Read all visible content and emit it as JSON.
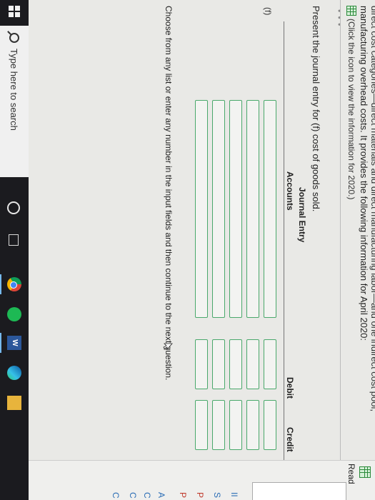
{
  "header": {
    "cut_line": "direct cost categories—direct materials and direct manufacturing labor—and one indirect cost pool,",
    "line2": "manufacturing overhead costs. It provides the following information for April 2020:",
    "click_note": "(Click the icon to view the information for 2020.)",
    "grid_icon": "table-grid-icon"
  },
  "question": {
    "prompt": "Present the journal entry for (f) cost of goods sold.",
    "journal_title": "Journal Entry",
    "col_accounts": "Accounts",
    "col_debit": "Debit",
    "col_credit": "Credit",
    "row_label": "(f)",
    "instruction": "Choose from any list or enter any number in the input fields and then continue to the next question."
  },
  "right_panel": {
    "read_label": "Read",
    "side_chars": [
      "II",
      "S",
      "P",
      "P",
      "A",
      "C",
      "C",
      "C"
    ]
  },
  "taskbar": {
    "search_placeholder": "Type here to search",
    "word_letter": "W",
    "accent_color": "#76b9ed"
  },
  "colors": {
    "field_border": "#4aa86b",
    "background": "#e9e9e6"
  }
}
